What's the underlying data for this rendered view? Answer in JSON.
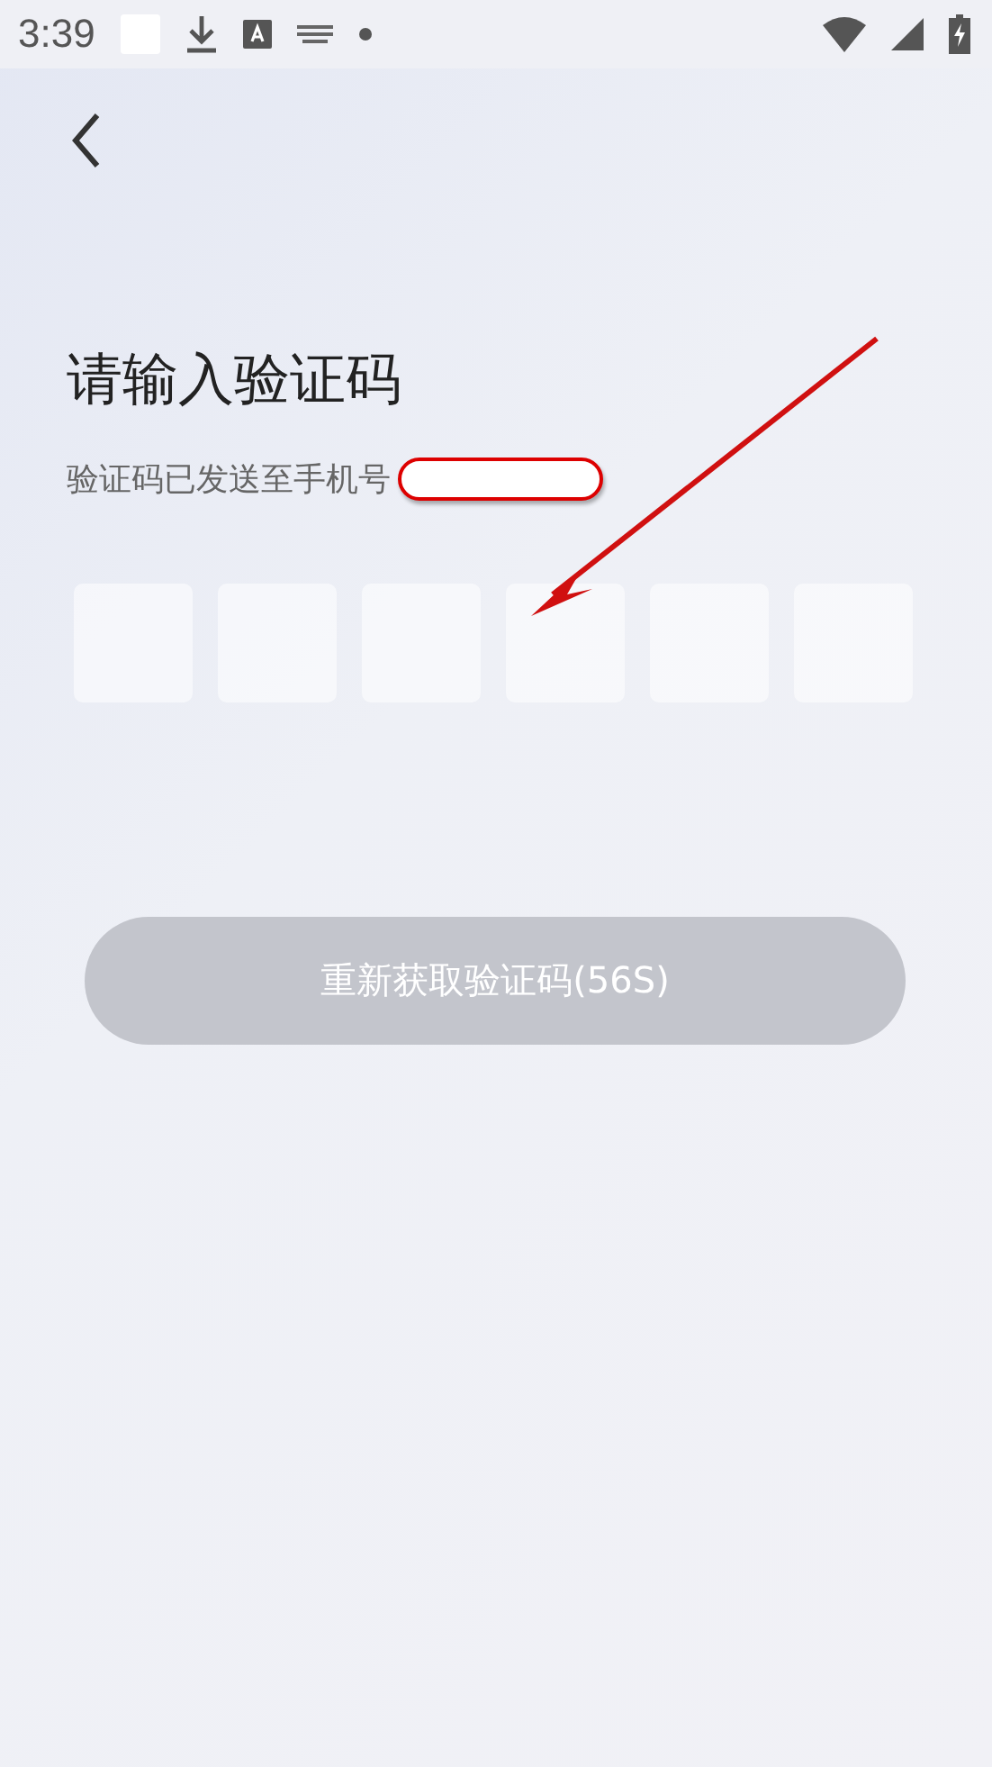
{
  "status_bar": {
    "time": "3:39"
  },
  "title": "请输入验证码",
  "subtitle": "验证码已发送至手机号",
  "code_boxes": [
    {
      "focused": false
    },
    {
      "focused": false
    },
    {
      "focused": false
    },
    {
      "focused": false
    },
    {
      "focused": false
    },
    {
      "focused": false
    }
  ],
  "resend_button": {
    "label": "重新获取验证码(56S)",
    "disabled": true
  }
}
